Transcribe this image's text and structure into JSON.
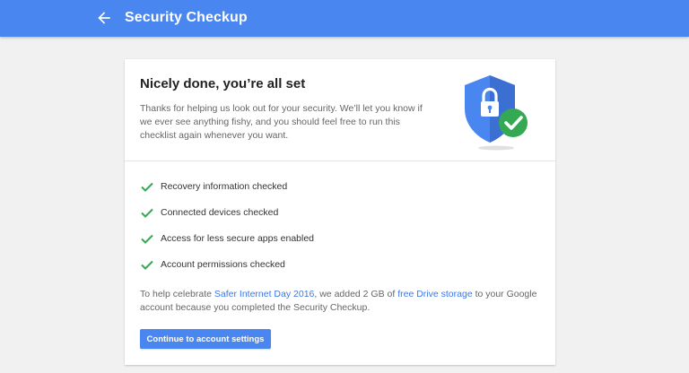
{
  "header": {
    "title": "Security Checkup",
    "back_icon": "arrow-back-icon",
    "bar_color": "#4a86f0"
  },
  "card": {
    "heading": "Nicely done, you’re all set",
    "intro": "Thanks for helping us look out for your security. We’ll let you know if we ever see anything fishy, and you should feel free to run this checklist again whenever you want.",
    "illustration_icon": "shield-lock-check-icon",
    "checklist": [
      {
        "label": "Recovery information checked",
        "icon": "check-icon"
      },
      {
        "label": "Connected devices checked",
        "icon": "check-icon"
      },
      {
        "label": "Access for less secure apps enabled",
        "icon": "check-icon"
      },
      {
        "label": "Account permissions checked",
        "icon": "check-icon"
      }
    ],
    "promo": {
      "part1": "To help celebrate ",
      "link1": "Safer Internet Day 2016",
      "part2": ", we added 2 GB of ",
      "link2": "free Drive storage",
      "part3": " to your Google account because you completed the Security Checkup."
    },
    "continue_label": "Continue to account settings"
  },
  "colors": {
    "accent": "#4a86f0",
    "check_green": "#34a853",
    "link": "#3b78e7"
  }
}
